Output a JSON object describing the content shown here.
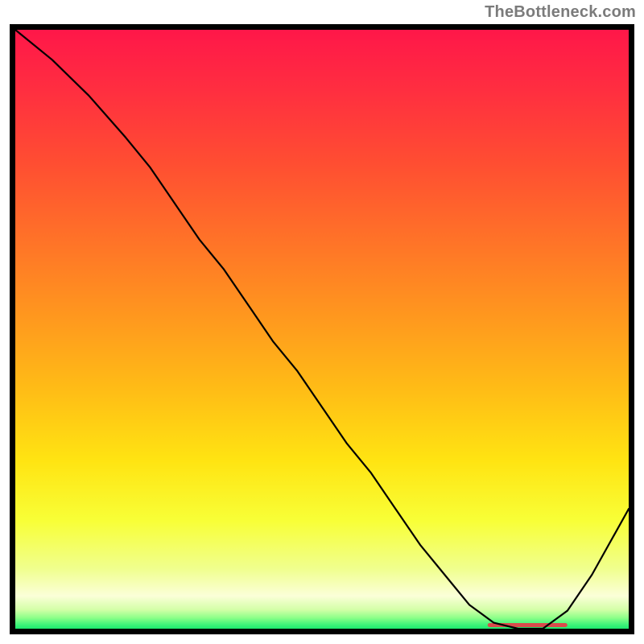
{
  "attribution_text": "TheBottleneck.com",
  "chart_data": {
    "type": "line",
    "title": "",
    "xlabel": "",
    "ylabel": "",
    "xlim": [
      0,
      100
    ],
    "ylim": [
      0,
      100
    ],
    "series": [
      {
        "name": "bottleneck-curve",
        "x": [
          0,
          6,
          12,
          18,
          22,
          26,
          30,
          34,
          38,
          42,
          46,
          50,
          54,
          58,
          62,
          66,
          70,
          74,
          78,
          82,
          86,
          90,
          94,
          100
        ],
        "y": [
          100,
          95,
          89,
          82,
          77,
          71,
          65,
          60,
          54,
          48,
          43,
          37,
          31,
          26,
          20,
          14,
          9,
          4,
          1,
          0,
          0,
          3,
          9,
          20
        ]
      }
    ],
    "annotations": [
      {
        "name": "optimal-zone-marker",
        "x_from": 77,
        "x_to": 90,
        "y": 0.6,
        "color": "#d94b4b",
        "thickness": 5
      }
    ],
    "gradient_stops": [
      {
        "offset": 0.0,
        "color": "#ff1749"
      },
      {
        "offset": 0.1,
        "color": "#ff2e40"
      },
      {
        "offset": 0.22,
        "color": "#ff4d32"
      },
      {
        "offset": 0.35,
        "color": "#ff7228"
      },
      {
        "offset": 0.48,
        "color": "#ff981e"
      },
      {
        "offset": 0.6,
        "color": "#ffbc16"
      },
      {
        "offset": 0.72,
        "color": "#ffe412"
      },
      {
        "offset": 0.82,
        "color": "#f8ff37"
      },
      {
        "offset": 0.9,
        "color": "#f0ff8e"
      },
      {
        "offset": 0.945,
        "color": "#fbffd8"
      },
      {
        "offset": 0.968,
        "color": "#d4ffa8"
      },
      {
        "offset": 0.982,
        "color": "#8bff88"
      },
      {
        "offset": 0.993,
        "color": "#3ff37a"
      },
      {
        "offset": 1.0,
        "color": "#1de96f"
      }
    ]
  }
}
